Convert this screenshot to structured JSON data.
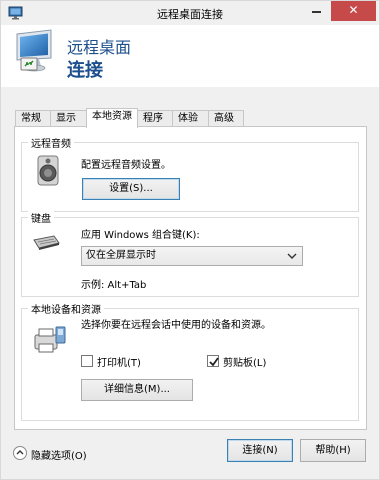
{
  "window": {
    "title": "远程桌面连接",
    "close_glyph": "✕"
  },
  "header": {
    "title": "远程桌面",
    "subtitle": "连接"
  },
  "tabs": [
    {
      "label": "常规",
      "active": false
    },
    {
      "label": "显示",
      "active": false
    },
    {
      "label": "本地资源",
      "active": true
    },
    {
      "label": "程序",
      "active": false
    },
    {
      "label": "体验",
      "active": false
    },
    {
      "label": "高级",
      "active": false
    }
  ],
  "remote_audio": {
    "group_title": "远程音频",
    "description": "配置远程音频设置。",
    "settings_button": "设置(S)..."
  },
  "keyboard": {
    "group_title": "键盘",
    "apply_label": "应用 Windows 组合键(K):",
    "selected_option": "仅在全屏显示时",
    "example": "示例: Alt+Tab"
  },
  "local_devices": {
    "group_title": "本地设备和资源",
    "description": "选择你要在远程会话中使用的设备和资源。",
    "printer_label": "打印机(T)",
    "printer_checked": false,
    "clipboard_label": "剪贴板(L)",
    "clipboard_checked": true,
    "details_button": "详细信息(M)..."
  },
  "footer": {
    "hide_options": "隐藏选项(O)",
    "connect_button": "连接(N)",
    "help_button": "帮助(H)"
  }
}
